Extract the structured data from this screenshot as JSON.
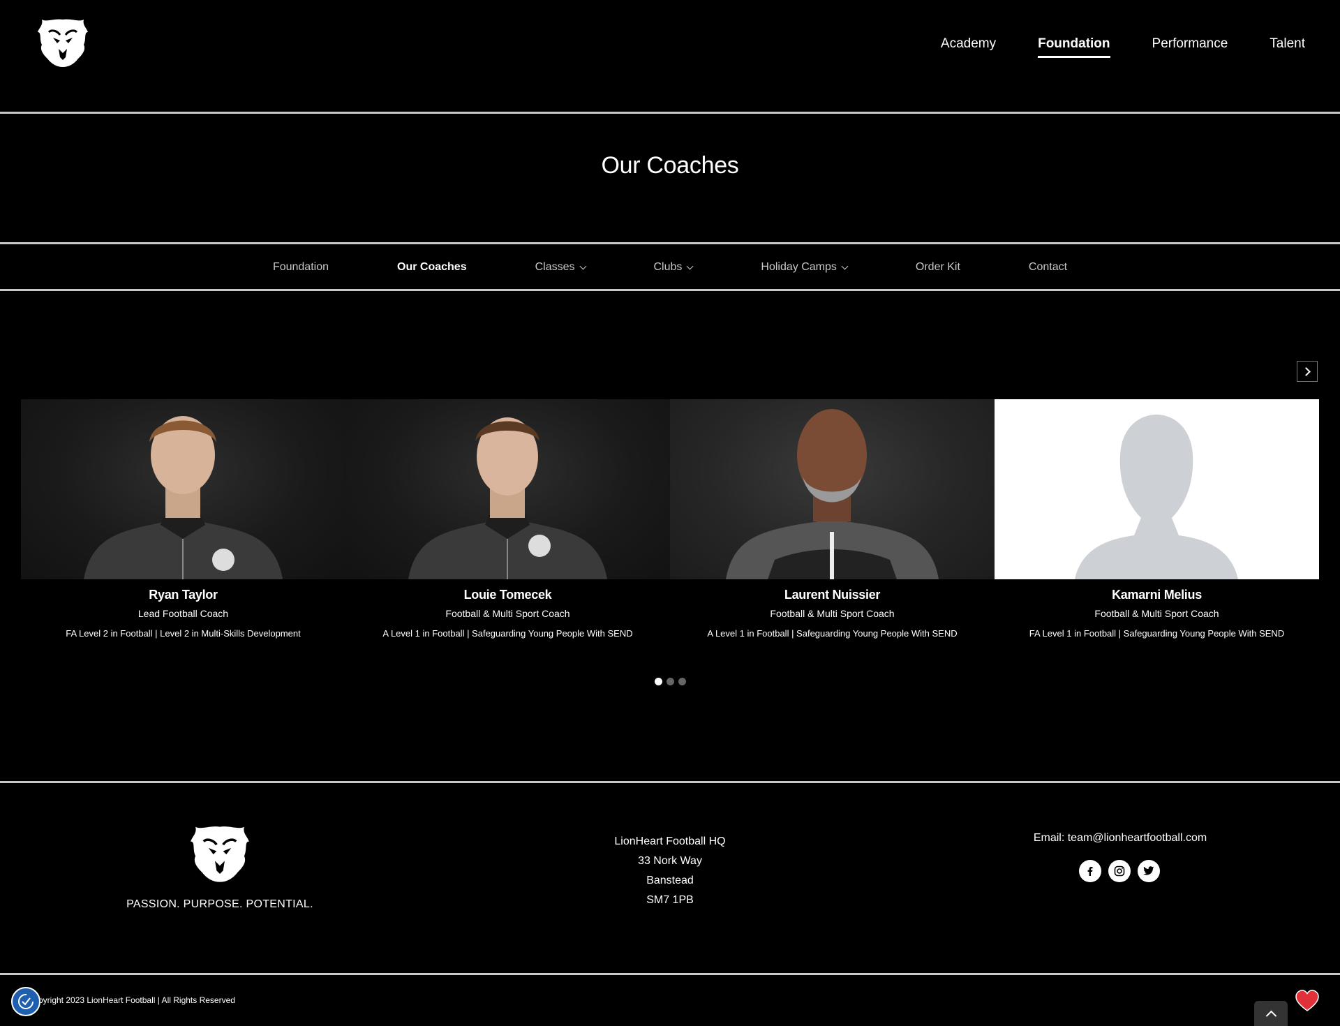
{
  "header": {
    "logo_alt": "LionHeart Football",
    "nav": [
      {
        "label": "Academy",
        "active": false
      },
      {
        "label": "Foundation",
        "active": true
      },
      {
        "label": "Performance",
        "active": false
      },
      {
        "label": "Talent",
        "active": false
      }
    ]
  },
  "page": {
    "title": "Our Coaches"
  },
  "subnav": [
    {
      "label": "Foundation",
      "active": false,
      "dropdown": false
    },
    {
      "label": "Our Coaches",
      "active": true,
      "dropdown": false
    },
    {
      "label": "Classes",
      "active": false,
      "dropdown": true
    },
    {
      "label": "Clubs",
      "active": false,
      "dropdown": true
    },
    {
      "label": "Holiday Camps",
      "active": false,
      "dropdown": true
    },
    {
      "label": "Order Kit",
      "active": false,
      "dropdown": false
    },
    {
      "label": "Contact",
      "active": false,
      "dropdown": false
    }
  ],
  "coaches": [
    {
      "name": "Ryan Taylor",
      "role": "Lead Football Coach",
      "qualifications": "FA Level 2 in Football | Level 2 in Multi-Skills Development",
      "photo": "coach-photo"
    },
    {
      "name": "Louie Tomecek",
      "role": "Football & Multi Sport Coach",
      "qualifications": "A Level 1 in Football | Safeguarding Young People With SEND",
      "photo": "coach-photo"
    },
    {
      "name": "Laurent Nuissier",
      "role": "Football & Multi Sport Coach",
      "qualifications": "A Level 1 in Football | Safeguarding Young People With SEND",
      "photo": "coach-photo"
    },
    {
      "name": "Kamarni Melius",
      "role": "Football & Multi Sport Coach",
      "qualifications": "FA Level 1 in Football | Safeguarding Young People With SEND",
      "photo": "placeholder-silhouette"
    }
  ],
  "carousel": {
    "pages": 3,
    "current": 1
  },
  "footer": {
    "tagline": "PASSION. PURPOSE. POTENTIAL.",
    "address": [
      "LionHeart Football HQ",
      "33 Nork Way",
      "Banstead",
      "SM7 1PB"
    ],
    "email_label": "Email:",
    "email": "team@lionheartfootball.com",
    "socials": [
      "facebook-icon",
      "instagram-icon",
      "twitter-icon"
    ],
    "copyright": "pyright 2023 LionHeart Football | All Rights Reserved"
  },
  "colors": {
    "background": "#000000",
    "text": "#ffffff",
    "divider": "#c8c8c8",
    "accessibility": "#1f5fb0",
    "heart": "#e0303a"
  }
}
